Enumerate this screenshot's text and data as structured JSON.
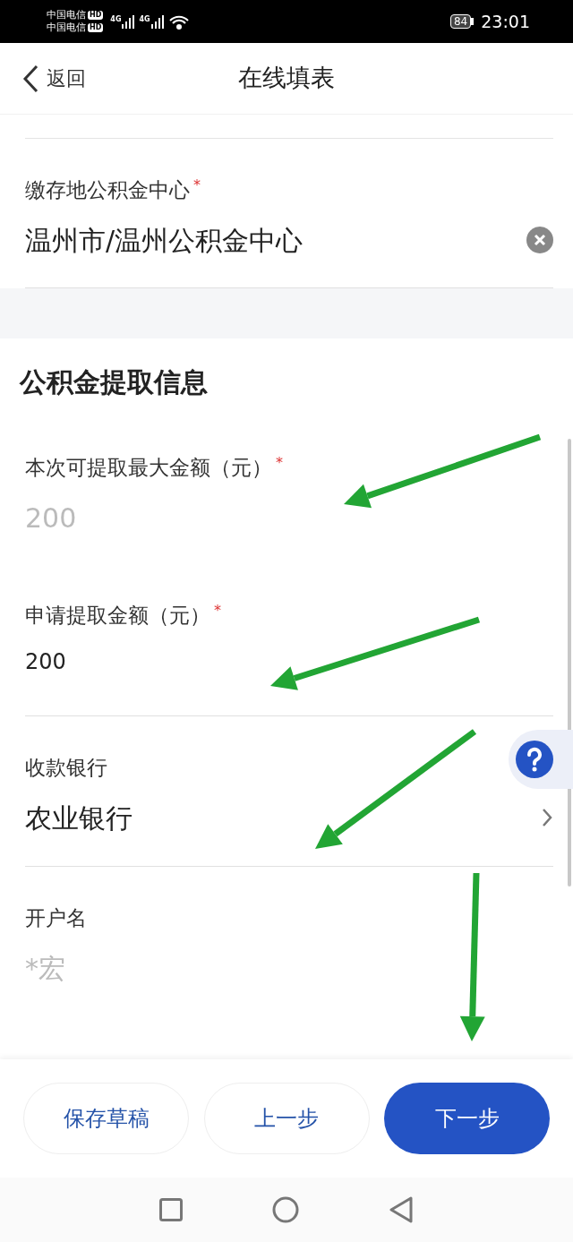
{
  "status_bar": {
    "carriers": [
      {
        "name": "中国电信",
        "badge": "HD"
      },
      {
        "name": "中国电信",
        "badge": "HD"
      }
    ],
    "networks": [
      "4G",
      "4G"
    ],
    "battery": "84",
    "time": "23:01"
  },
  "header": {
    "back": "返回",
    "title": "在线填表"
  },
  "top_fields": [
    {
      "kind": "clearable",
      "label": "缴存地公积金中心",
      "required_mark": "*",
      "value": "温州市/温州公积金中心",
      "disabled": false,
      "divider": true
    }
  ],
  "section": {
    "title": "公积金提取信息",
    "fields": [
      {
        "kind": "text",
        "label": "本次可提取最大金额（元）",
        "required_mark": "*",
        "value": "200",
        "disabled": true,
        "divider": false
      },
      {
        "kind": "input",
        "label": "申请提取金额（元）",
        "required_mark": "*",
        "value": "200",
        "disabled": false,
        "divider": true
      },
      {
        "kind": "picker",
        "label": "收款银行",
        "value": "农业银行",
        "disabled": false,
        "divider": true
      },
      {
        "kind": "text",
        "label": "开户名",
        "value": "*宏",
        "disabled": true,
        "divider": false
      }
    ]
  },
  "buttons": [
    {
      "label": "保存草稿",
      "kind": "secondary"
    },
    {
      "label": "上一步",
      "kind": "secondary"
    },
    {
      "label": "下一步",
      "kind": "primary"
    }
  ]
}
